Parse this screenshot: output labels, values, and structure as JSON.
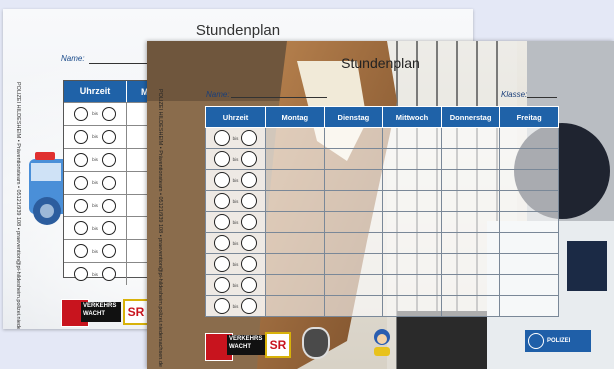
{
  "back_card": {
    "title": "Stundenplan",
    "name_label": "Name:",
    "vertical_text": "POLIZEI HILDESHEIM • Präventionsteam • 05121/939 108 • praevention@pi-hildesheim.polizei.niedersachsen.de",
    "header": [
      "Uhrzeit",
      "Mo"
    ],
    "row_count": 8,
    "time_separator": "bis",
    "logo_vw": "VERKEHRS WACHT",
    "logo_sr": "SR"
  },
  "front_card": {
    "title": "Stundenplan",
    "name_label": "Name:",
    "class_label": "Klasse:",
    "vertical_text": "POLIZEI HILDESHEIM • Präventionsteam • 05121/939 108 • praevention@pi-hildesheim.polizei.niedersachsen.de",
    "columns": [
      "Uhrzeit",
      "Montag",
      "Dienstag",
      "Mittwoch",
      "Donnerstag",
      "Freitag"
    ],
    "row_count": 9,
    "time_separator": "bis",
    "logo_vw": "VERKEHRS WACHT",
    "logo_sr": "SR",
    "polizei_logo": "POLIZEI"
  },
  "colors": {
    "header_blue": "#1f62a8",
    "background": "#e4e8f6"
  }
}
